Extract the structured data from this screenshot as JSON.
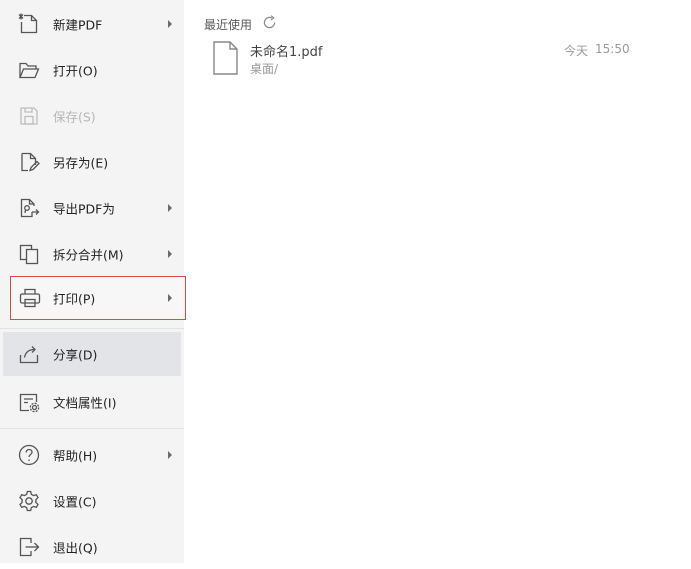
{
  "sidebar": {
    "items": [
      {
        "label": "新建PDF",
        "icon": "new-pdf-icon",
        "has_submenu": true
      },
      {
        "label": "打开(O)",
        "icon": "open-folder-icon",
        "has_submenu": false
      },
      {
        "label": "保存(S)",
        "icon": "save-icon",
        "has_submenu": false,
        "disabled": true
      },
      {
        "label": "另存为(E)",
        "icon": "save-as-icon",
        "has_submenu": false
      },
      {
        "label": "导出PDF为",
        "icon": "export-pdf-icon",
        "has_submenu": true
      },
      {
        "label": "拆分合并(M)",
        "icon": "split-merge-icon",
        "has_submenu": true
      },
      {
        "label": "打印(P)",
        "icon": "printer-icon",
        "has_submenu": true,
        "highlighted": true
      },
      {
        "label": "分享(D)",
        "icon": "share-icon",
        "has_submenu": false,
        "selected": true
      },
      {
        "label": "文档属性(I)",
        "icon": "document-properties-icon",
        "has_submenu": false
      },
      {
        "label": "帮助(H)",
        "icon": "help-icon",
        "has_submenu": true
      },
      {
        "label": "设置(C)",
        "icon": "settings-gear-icon",
        "has_submenu": false
      },
      {
        "label": "退出(Q)",
        "icon": "exit-icon",
        "has_submenu": false
      }
    ]
  },
  "recent": {
    "title": "最近使用",
    "refresh_icon": "refresh-icon",
    "files": [
      {
        "name": "未命名1.pdf",
        "path": "桌面/",
        "date": "今天",
        "time": "15:50",
        "icon": "file-icon"
      }
    ]
  },
  "colors": {
    "sidebar_bg": "#f4f4f5",
    "highlight_border": "#e04848",
    "selected_bg": "#e3e4e7",
    "disabled_text": "#b6b6b6"
  }
}
